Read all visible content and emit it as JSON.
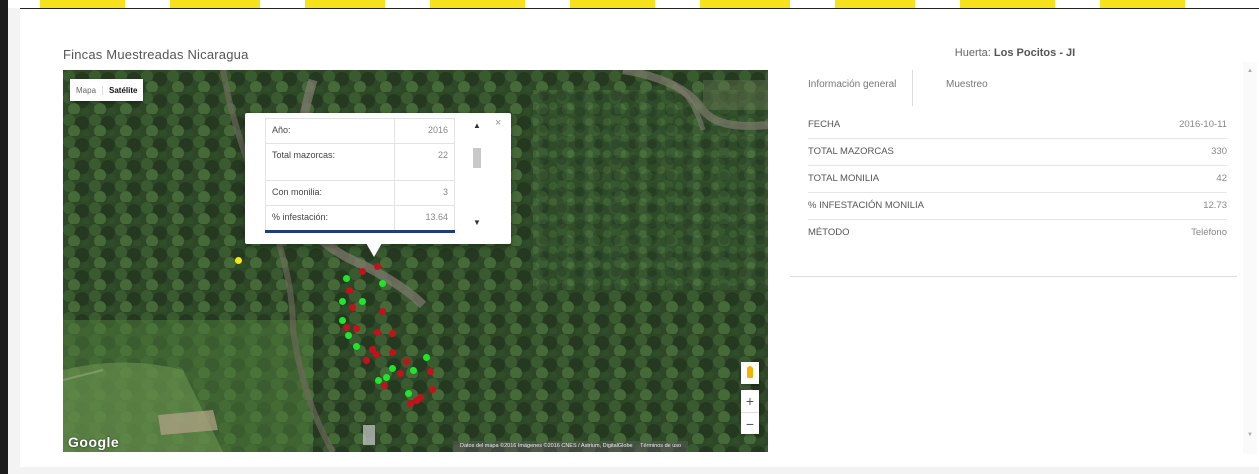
{
  "map_title": "Fincas Muestreadas Nicaragua",
  "map_type": {
    "options": [
      "Mapa",
      "Satélite"
    ],
    "selected": "Satélite"
  },
  "popup": {
    "rows": [
      {
        "label": "Año:",
        "value": "2016"
      },
      {
        "label": "Total mazorcas:",
        "value": "22"
      },
      {
        "label": "Con monilia:",
        "value": "3"
      },
      {
        "label": "% infestación:",
        "value": "13.64"
      }
    ],
    "close_label": "×",
    "scroll_up": "▲",
    "scroll_down": "▼"
  },
  "google_logo": "Google",
  "attribution": [
    "Datos del mapa ©2016 Imágenes ©2016 CNES / Astrium, DigitalGlobe",
    "Términos de uso"
  ],
  "zoom": {
    "plus": "+",
    "minus": "−"
  },
  "markers": {
    "colors": {
      "green": "#1ee62b",
      "red": "#c8101c",
      "yellow": "#f4e813"
    }
  },
  "panel": {
    "title_prefix": "Huerta:",
    "title_name": "Los Pocitos - JI",
    "tabs": [
      "Información general",
      "Muestreo"
    ],
    "active_tab": "Información general",
    "info_rows": [
      {
        "key": "FECHA",
        "value": "2016-10-11"
      },
      {
        "key": "TOTAL MAZORCAS",
        "value": "330"
      },
      {
        "key": "TOTAL MONILIA",
        "value": "42"
      },
      {
        "key": "% INFESTACIÓN MONILIA",
        "value": "12.73"
      },
      {
        "key": "MÉTODO",
        "value": "Teléfono"
      }
    ]
  },
  "colors": {
    "accent_band": "#f6e21c",
    "popup_bar": "#1f3d7a"
  },
  "icons": {
    "pegman": "pegman-icon",
    "scroll_up": "arrow-up-icon",
    "scroll_down": "arrow-down-icon"
  }
}
